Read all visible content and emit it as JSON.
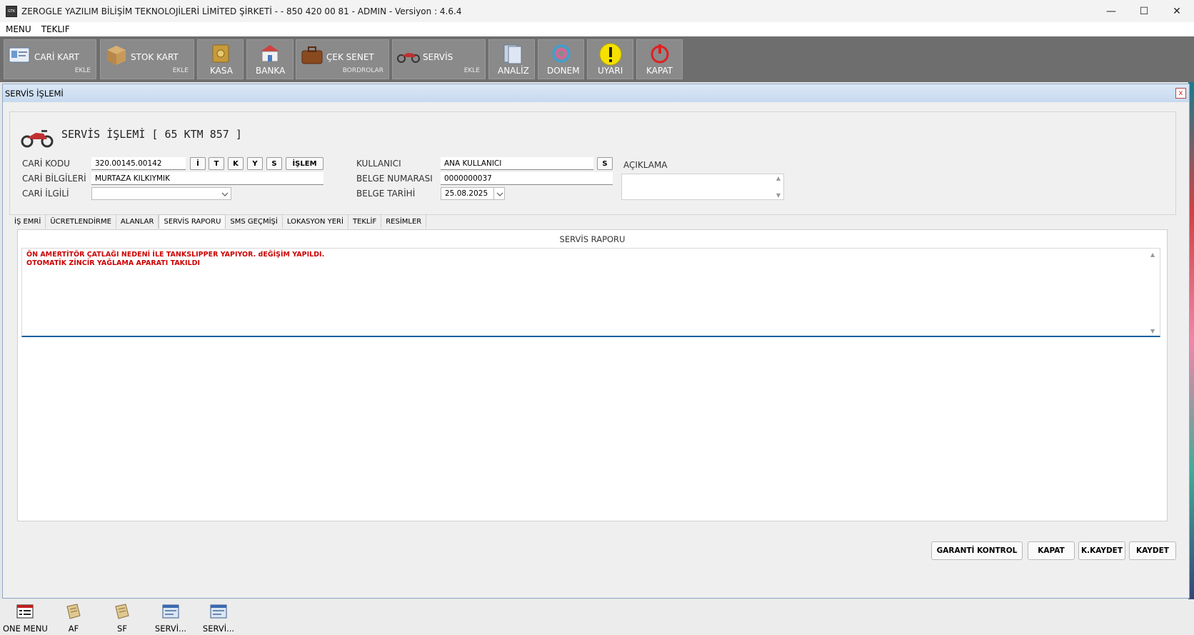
{
  "window": {
    "title": "ZEROGLE YAZILIM BİLİŞİM TEKNOLOJİLERİ LİMİTED ŞİRKETİ -  - 850 420 00 81 - ADMIN -  Versiyon : 4.6.4",
    "icon_label": "GTK",
    "controls": {
      "minimize": "—",
      "maximize": "☐",
      "close": "✕"
    }
  },
  "menu": [
    "MENU",
    "TEKLIF"
  ],
  "toolbar": [
    {
      "label": "CARİ KART",
      "sub": "EKLE",
      "icon": "id-card-icon"
    },
    {
      "label": "STOK KART",
      "sub": "EKLE",
      "icon": "box-icon"
    },
    {
      "label": "KASA",
      "sub": "",
      "icon": "safe-icon"
    },
    {
      "label": "BANKA",
      "sub": "",
      "icon": "bank-icon"
    },
    {
      "label": "ÇEK SENET",
      "sub": "BORDROLAR",
      "icon": "briefcase-icon"
    },
    {
      "label": "SERVİS",
      "sub": "EKLE",
      "icon": "motorcycle-icon"
    },
    {
      "label": "ANALİZ",
      "sub": "",
      "icon": "binder-icon"
    },
    {
      "label": "DONEM",
      "sub": "",
      "icon": "cycle-icon"
    },
    {
      "label": "UYARI",
      "sub": "",
      "icon": "warning-icon"
    },
    {
      "label": "KAPAT",
      "sub": "",
      "icon": "power-icon"
    }
  ],
  "child_window": {
    "title": "SERVİS İŞLEMİ",
    "close": "x",
    "heading": "SERVİS İŞLEMİ [ 65 KTM 857 ]"
  },
  "form": {
    "cari_kodu_label": "CARİ KODU",
    "cari_kodu_value": "320.00145.00142",
    "cari_bilgileri_label": "CARİ BİLGİLERİ",
    "cari_bilgileri_value": "MURTAZA KILKIYMIK",
    "cari_ilgili_label": "CARİ İLGİLİ",
    "cari_ilgili_value": "",
    "cari_buttons": [
      "İ",
      "T",
      "K",
      "Y",
      "S",
      "İŞLEM"
    ],
    "kullanici_label": "KULLANICI",
    "kullanici_value": "ANA KULLANICI",
    "kullanici_button": "S",
    "belge_no_label": "BELGE NUMARASI",
    "belge_no_value": "0000000037",
    "belge_tarihi_label": "BELGE TARİHİ",
    "belge_tarihi_value": "25.08.2025",
    "aciklama_label": "AÇIKLAMA",
    "aciklama_value": ""
  },
  "tabs": [
    "İŞ EMRİ",
    "ÜCRETLENDİRME",
    "ALANLAR",
    "SERVİS RAPORU",
    "SMS GEÇMİŞİ",
    "LOKASYON YERİ",
    "TEKLİF",
    "RESİMLER"
  ],
  "active_tab": "SERVİS RAPORU",
  "report": {
    "header": "SERVİS RAPORU",
    "lines": [
      "ÖN AMERTİTÖR ÇATLAĞI NEDENİ İLE TANKSLIPPER YAPIYOR. dEĞİŞİM YAPILDI.",
      "OTOMATİK ZİNCİR YAĞLAMA APARATI TAKILDI"
    ]
  },
  "buttons": {
    "garanti": "GARANTİ KONTROL",
    "kapat": "KAPAT",
    "kkaydet": "K.KAYDET",
    "kaydet": "KAYDET"
  },
  "taskbar": [
    {
      "label": "ONE MENU",
      "icon": "menu-window-icon"
    },
    {
      "label": "AF",
      "icon": "document-icon"
    },
    {
      "label": "SF",
      "icon": "document-icon"
    },
    {
      "label": "SERVİ...",
      "icon": "form-window-icon"
    },
    {
      "label": "SERVİ...",
      "icon": "form-window-icon"
    }
  ],
  "colors": {
    "toolbar_bg": "#6e6e6e",
    "toolbar_button": "#8a8a8a",
    "report_text": "#cc0000",
    "title_gradient": "#c6d9ef",
    "focus_line": "#1d5fa0"
  }
}
